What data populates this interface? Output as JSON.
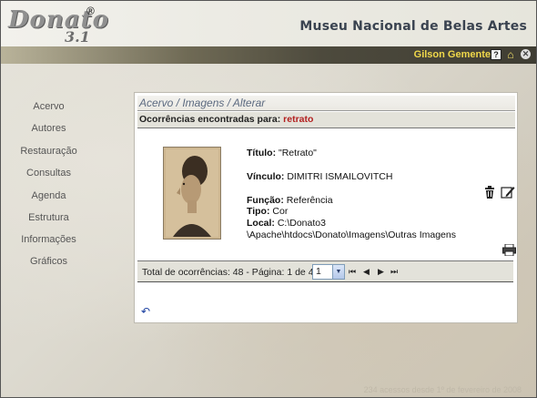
{
  "header": {
    "logo_word": "Donato",
    "logo_version": "3.1",
    "logo_mark": "®",
    "app_title": "Museu Nacional de Belas Artes"
  },
  "userbar": {
    "username": "Gilson Gemente",
    "icons": [
      "help-icon",
      "home-icon",
      "close-icon"
    ]
  },
  "sidebar": {
    "items": [
      {
        "label": "Acervo"
      },
      {
        "label": "Autores"
      },
      {
        "label": "Restauração"
      },
      {
        "label": "Consultas"
      },
      {
        "label": "Agenda"
      },
      {
        "label": "Estrutura"
      },
      {
        "label": "Informações"
      },
      {
        "label": "Gráficos"
      }
    ]
  },
  "panel": {
    "breadcrumb": "Acervo / Imagens / Alterar",
    "occurrences_label": "Ocorrências encontradas para:",
    "search_term": "retrato",
    "record": {
      "titulo_label": "Título:",
      "titulo_value": "\"Retrato\"",
      "vinculo_label": "Vínculo:",
      "vinculo_value": "DIMITRI ISMAILOVITCH",
      "funcao_label": "Função:",
      "funcao_value": "Referência",
      "tipo_label": "Tipo:",
      "tipo_value": "Cor",
      "local_label": "Local:",
      "local_value_line1": "C:\\Donato3",
      "local_value_line2": "\\Apache\\htdocs\\Donato\\Imagens\\Outras Imagens"
    },
    "pager": {
      "text": "Total de ocorrências: 48 - Página: 1 de 48",
      "selected_page": "1"
    }
  },
  "footer": {
    "text": "234 acessos desde 1º de fevereiro de 2008"
  },
  "colors": {
    "accent_title": "#3a4350",
    "username": "#f0d84a",
    "search_term": "#b32020",
    "breadcrumb": "#5c6a80"
  }
}
